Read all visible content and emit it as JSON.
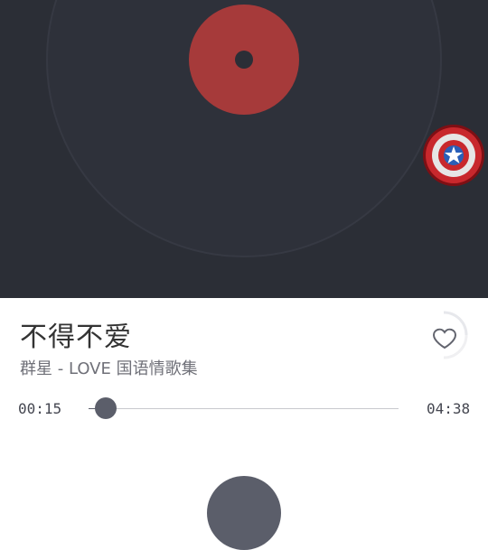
{
  "song": {
    "title": "不得不爱",
    "artist_album": "群星 - LOVE 国语情歌集"
  },
  "playback": {
    "current_time": "00:15",
    "total_time": "04:38",
    "progress": 0.054
  },
  "icons": {
    "favorite": "heart-outline-icon",
    "badge": "captain-america-shield-icon",
    "play": "play-button"
  },
  "colors": {
    "header_bg": "#2b2e36",
    "record_label": "#a63a3a",
    "accent": "#5b5e6a"
  }
}
